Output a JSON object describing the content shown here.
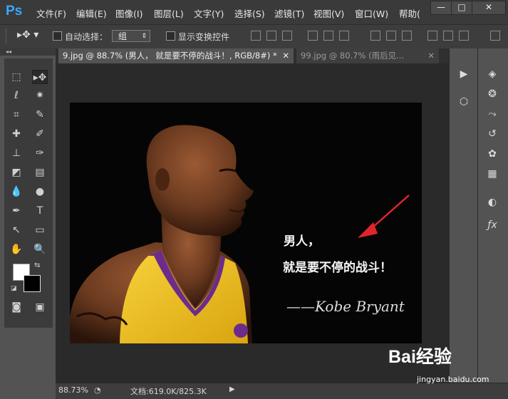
{
  "app": {
    "logo": "Ps"
  },
  "menu": [
    "文件(F)",
    "编辑(E)",
    "图像(I)",
    "图层(L)",
    "文字(Y)",
    "选择(S)",
    "滤镜(T)",
    "视图(V)",
    "窗口(W)",
    "帮助("
  ],
  "window_controls": {
    "minimize": "—",
    "restore": "□",
    "close": "✕"
  },
  "options": {
    "auto_select_label": "自动选择：",
    "auto_select_value": "组",
    "show_transform_label": "显示变换控件"
  },
  "tabs": [
    {
      "label": "9.jpg @ 88.7% (男人，  就是要不停的战斗！, RGB/8#) *",
      "close": "✕"
    },
    {
      "label": "99.jpg @ 80.7% (雨后见...",
      "close": "✕"
    }
  ],
  "image_text": {
    "line1": "男人，",
    "line2": "就是要不停的战斗！",
    "signature": "——Kobe Bryant"
  },
  "status": {
    "zoom": "88.73%",
    "doc_info": "文档:619.0K/825.3K"
  },
  "watermark": {
    "logo": "Bai经验",
    "url": "jingyan.baidu.com"
  },
  "colors": {
    "ps_blue": "#37a8ff",
    "arrow_red": "#e0262b",
    "jersey_yellow": "#f3c21c"
  }
}
